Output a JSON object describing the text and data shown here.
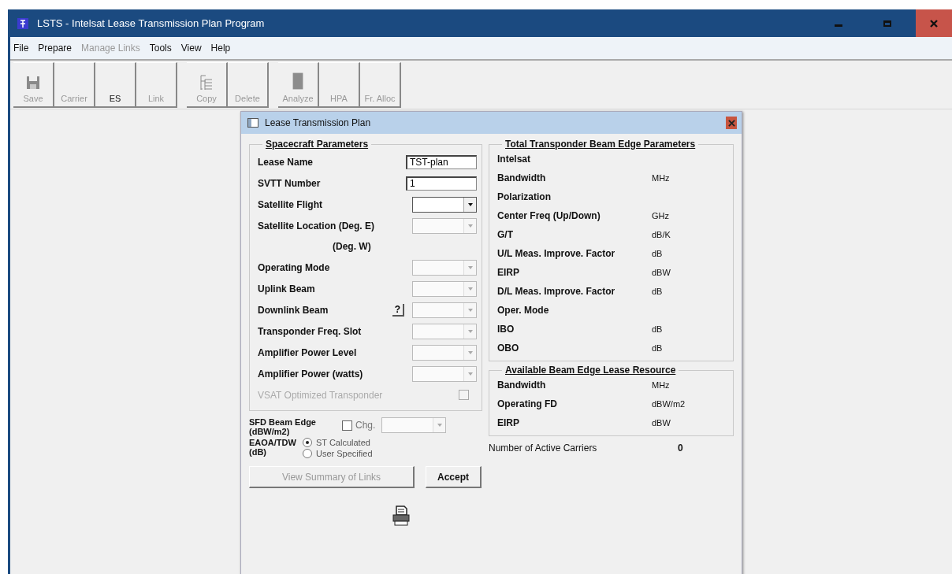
{
  "window": {
    "title": "LSTS - Intelsat Lease Transmission Plan Program"
  },
  "menu": [
    {
      "label": "File",
      "disabled": false
    },
    {
      "label": "Prepare",
      "disabled": false
    },
    {
      "label": "Manage Links",
      "disabled": true
    },
    {
      "label": "Tools",
      "disabled": false
    },
    {
      "label": "View",
      "disabled": false
    },
    {
      "label": "Help",
      "disabled": false
    }
  ],
  "toolbar": [
    [
      {
        "label": "Save",
        "disabled": true
      },
      {
        "label": "Carrier",
        "disabled": true
      },
      {
        "label": "ES",
        "disabled": false
      },
      {
        "label": "Link",
        "disabled": true
      }
    ],
    [
      {
        "label": "Copy",
        "disabled": true
      },
      {
        "label": "Delete",
        "disabled": true
      }
    ],
    [
      {
        "label": "Analyze",
        "disabled": true
      },
      {
        "label": "HPA",
        "disabled": true
      },
      {
        "label": "Fr. Alloc",
        "disabled": true
      }
    ]
  ],
  "dialog": {
    "title": "Lease Transmission Plan",
    "spacecraft": {
      "heading": "Spacecraft Parameters",
      "fields": [
        {
          "kind": "text",
          "label": "Lease Name",
          "value": "TST-plan"
        },
        {
          "kind": "text",
          "label": "SVTT Number",
          "value": "1"
        },
        {
          "kind": "combo",
          "label": "Satellite Flight",
          "disabled": false
        },
        {
          "kind": "combo",
          "label": "Satellite Location (Deg. E)",
          "disabled": true
        },
        {
          "kind": "note",
          "label": "(Deg. W)"
        },
        {
          "kind": "combo",
          "label": "Operating Mode",
          "disabled": true
        },
        {
          "kind": "combo",
          "label": "Uplink Beam",
          "disabled": true
        },
        {
          "kind": "combo",
          "label": "Downlink Beam",
          "help": "?",
          "disabled": true
        },
        {
          "kind": "combo",
          "label": "Transponder Freq. Slot",
          "disabled": true
        },
        {
          "kind": "combo",
          "label": "Amplifier Power Level",
          "disabled": true
        },
        {
          "kind": "combo",
          "label": "Amplifier Power (watts)",
          "disabled": true
        },
        {
          "kind": "checkbox",
          "label": "VSAT Optimized Transponder",
          "checked": false,
          "disabled": true
        }
      ]
    },
    "sfd": {
      "label": "SFD Beam Edge (dBW/m2)",
      "checkbox_label": "Chg.",
      "checked": false
    },
    "tdw": {
      "label": "EAOA/TDW (dB)",
      "options": [
        {
          "label": "ST Calculated",
          "selected": true
        },
        {
          "label": "User Specified",
          "selected": false
        }
      ]
    },
    "buttons": [
      {
        "label": "View Summary of Links",
        "disabled": true
      },
      {
        "label": "Accept",
        "disabled": false
      }
    ],
    "beam_edge": {
      "heading": "Total Transponder Beam Edge Parameters",
      "rows": [
        {
          "label": "Intelsat"
        },
        {
          "label": "Bandwidth",
          "unit": "MHz"
        },
        {
          "label": "Polarization"
        },
        {
          "label": "Center Freq (Up/Down)",
          "unit": "GHz"
        },
        {
          "label": "G/T",
          "unit": "dB/K"
        },
        {
          "label": "U/L Meas. Improve. Factor",
          "unit": "dB"
        },
        {
          "label": "EIRP",
          "unit": "dBW"
        },
        {
          "label": "D/L Meas. Improve. Factor",
          "unit": "dB"
        },
        {
          "label": "Oper. Mode"
        },
        {
          "label": "IBO",
          "unit": "dB"
        },
        {
          "label": "OBO",
          "unit": "dB"
        }
      ]
    },
    "available": {
      "heading": "Available Beam Edge Lease Resource",
      "rows": [
        {
          "label": "Bandwidth",
          "unit": "MHz"
        },
        {
          "label": "Operating FD",
          "unit": "dBW/m2"
        },
        {
          "label": "EIRP",
          "unit": "dBW"
        }
      ]
    },
    "active_carriers": {
      "label": "Number of Active Carriers",
      "value": "0"
    }
  }
}
